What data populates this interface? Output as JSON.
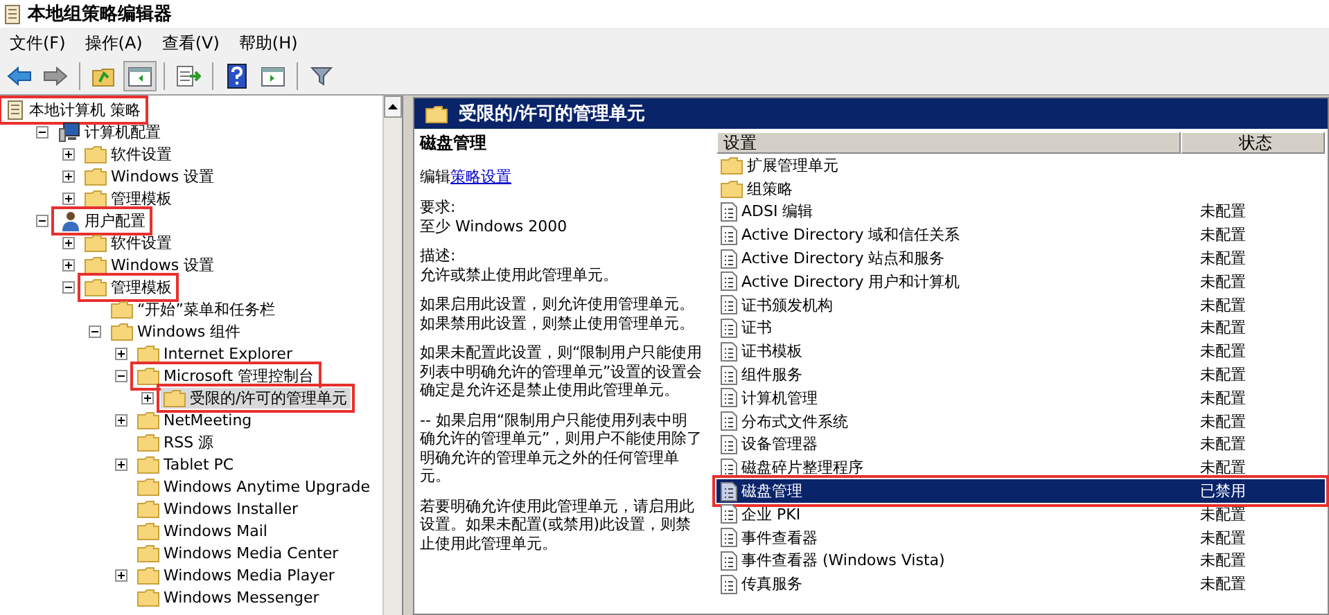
{
  "window": {
    "title": "本地组策略编辑器"
  },
  "menu": [
    "文件(F)",
    "操作(A)",
    "查看(V)",
    "帮助(H)"
  ],
  "tree": {
    "label": "本地计算机 策略",
    "kind": "root",
    "selected": false,
    "highlighted": true,
    "children": [
      {
        "label": "计算机配置",
        "kind": "computer",
        "expanded": true,
        "selected": false,
        "highlighted": false,
        "children": [
          {
            "label": "软件设置",
            "kind": "folder",
            "expanded": false,
            "selected": false,
            "highlighted": false
          },
          {
            "label": "Windows 设置",
            "kind": "folder",
            "expanded": false,
            "selected": false,
            "highlighted": false
          },
          {
            "label": "管理模板",
            "kind": "folder",
            "expanded": false,
            "selected": false,
            "highlighted": false
          }
        ]
      },
      {
        "label": "用户配置",
        "kind": "user",
        "expanded": true,
        "selected": false,
        "highlighted": true,
        "children": [
          {
            "label": "软件设置",
            "kind": "folder",
            "expanded": false,
            "selected": false,
            "highlighted": false
          },
          {
            "label": "Windows 设置",
            "kind": "folder",
            "expanded": false,
            "selected": false,
            "highlighted": false
          },
          {
            "label": "管理模板",
            "kind": "folder",
            "expanded": true,
            "selected": false,
            "highlighted": true,
            "children": [
              {
                "label": "“开始”菜单和任务栏",
                "kind": "folder",
                "selected": false,
                "highlighted": false
              },
              {
                "label": "Windows 组件",
                "kind": "folder",
                "expanded": true,
                "selected": false,
                "highlighted": false,
                "children": [
                  {
                    "label": "Internet Explorer",
                    "kind": "folder",
                    "expanded": false,
                    "selected": false,
                    "highlighted": false
                  },
                  {
                    "label": "Microsoft 管理控制台",
                    "kind": "folder",
                    "expanded": true,
                    "selected": false,
                    "highlighted": true,
                    "children": [
                      {
                        "label": "受限的/许可的管理单元",
                        "kind": "folder",
                        "expanded": false,
                        "selected": true,
                        "highlighted": true
                      }
                    ]
                  },
                  {
                    "label": "NetMeeting",
                    "kind": "folder",
                    "expanded": false,
                    "selected": false,
                    "highlighted": false
                  },
                  {
                    "label": "RSS 源",
                    "kind": "folder",
                    "selected": false,
                    "highlighted": false
                  },
                  {
                    "label": "Tablet PC",
                    "kind": "folder",
                    "expanded": false,
                    "selected": false,
                    "highlighted": false
                  },
                  {
                    "label": "Windows Anytime Upgrade",
                    "kind": "folder",
                    "selected": false,
                    "highlighted": false
                  },
                  {
                    "label": "Windows Installer",
                    "kind": "folder",
                    "selected": false,
                    "highlighted": false
                  },
                  {
                    "label": "Windows Mail",
                    "kind": "folder",
                    "selected": false,
                    "highlighted": false
                  },
                  {
                    "label": "Windows Media Center",
                    "kind": "folder",
                    "selected": false,
                    "highlighted": false
                  },
                  {
                    "label": "Windows Media Player",
                    "kind": "folder",
                    "expanded": false,
                    "selected": false,
                    "highlighted": false
                  },
                  {
                    "label": "Windows Messenger",
                    "kind": "folder",
                    "selected": false,
                    "highlighted": false
                  }
                ]
              }
            ]
          }
        ]
      }
    ]
  },
  "detail": {
    "title": "受限的/许可的管理单元",
    "heading": "磁盘管理",
    "edit_prefix": "编辑",
    "edit_link": "策略设置",
    "paragraphs": [
      "要求:\n至少 Windows 2000",
      "描述:\n允许或禁止使用此管理单元。",
      "如果启用此设置，则允许使用管理单元。如果禁用此设置，则禁止使用管理单元。",
      "如果未配置此设置，则“限制用户只能使用列表中明确允许的管理单元”设置的设置会确定是允许还是禁止使用此管理单元。",
      "-- 如果启用“限制用户只能使用列表中明确允许的管理单元”，则用户不能使用除了明确允许的管理单元之外的任何管理单元。",
      "若要明确允许使用此管理单元，请启用此设置。如果未配置(或禁用)此设置，则禁止使用此管理单元。"
    ]
  },
  "settings": {
    "columns": [
      "设置",
      "状态"
    ],
    "rows": [
      {
        "name": "扩展管理单元",
        "kind": "folder",
        "selected": false,
        "highlighted": false
      },
      {
        "name": "组策略",
        "kind": "folder",
        "selected": false,
        "highlighted": false
      },
      {
        "name": "ADSI 编辑",
        "status": "未配置",
        "kind": "policy",
        "selected": false,
        "highlighted": false
      },
      {
        "name": "Active Directory 域和信任关系",
        "status": "未配置",
        "kind": "policy",
        "selected": false,
        "highlighted": false
      },
      {
        "name": "Active Directory 站点和服务",
        "status": "未配置",
        "kind": "policy",
        "selected": false,
        "highlighted": false
      },
      {
        "name": "Active Directory 用户和计算机",
        "status": "未配置",
        "kind": "policy",
        "selected": false,
        "highlighted": false
      },
      {
        "name": "证书颁发机构",
        "status": "未配置",
        "kind": "policy",
        "selected": false,
        "highlighted": false
      },
      {
        "name": "证书",
        "status": "未配置",
        "kind": "policy",
        "selected": false,
        "highlighted": false
      },
      {
        "name": "证书模板",
        "status": "未配置",
        "kind": "policy",
        "selected": false,
        "highlighted": false
      },
      {
        "name": "组件服务",
        "status": "未配置",
        "kind": "policy",
        "selected": false,
        "highlighted": false
      },
      {
        "name": "计算机管理",
        "status": "未配置",
        "kind": "policy",
        "selected": false,
        "highlighted": false
      },
      {
        "name": "分布式文件系统",
        "status": "未配置",
        "kind": "policy",
        "selected": false,
        "highlighted": false
      },
      {
        "name": "设备管理器",
        "status": "未配置",
        "kind": "policy",
        "selected": false,
        "highlighted": false
      },
      {
        "name": "磁盘碎片整理程序",
        "status": "未配置",
        "kind": "policy",
        "selected": false,
        "highlighted": false
      },
      {
        "name": "磁盘管理",
        "status": "已禁用",
        "kind": "policy",
        "selected": true,
        "highlighted": true
      },
      {
        "name": "企业 PKI",
        "status": "未配置",
        "kind": "policy",
        "selected": false,
        "highlighted": false
      },
      {
        "name": "事件查看器",
        "status": "未配置",
        "kind": "policy",
        "selected": false,
        "highlighted": false
      },
      {
        "name": "事件查看器 (Windows Vista)",
        "status": "未配置",
        "kind": "policy",
        "selected": false,
        "highlighted": false
      },
      {
        "name": "传真服务",
        "status": "未配置",
        "kind": "policy",
        "selected": false,
        "highlighted": false
      }
    ]
  }
}
